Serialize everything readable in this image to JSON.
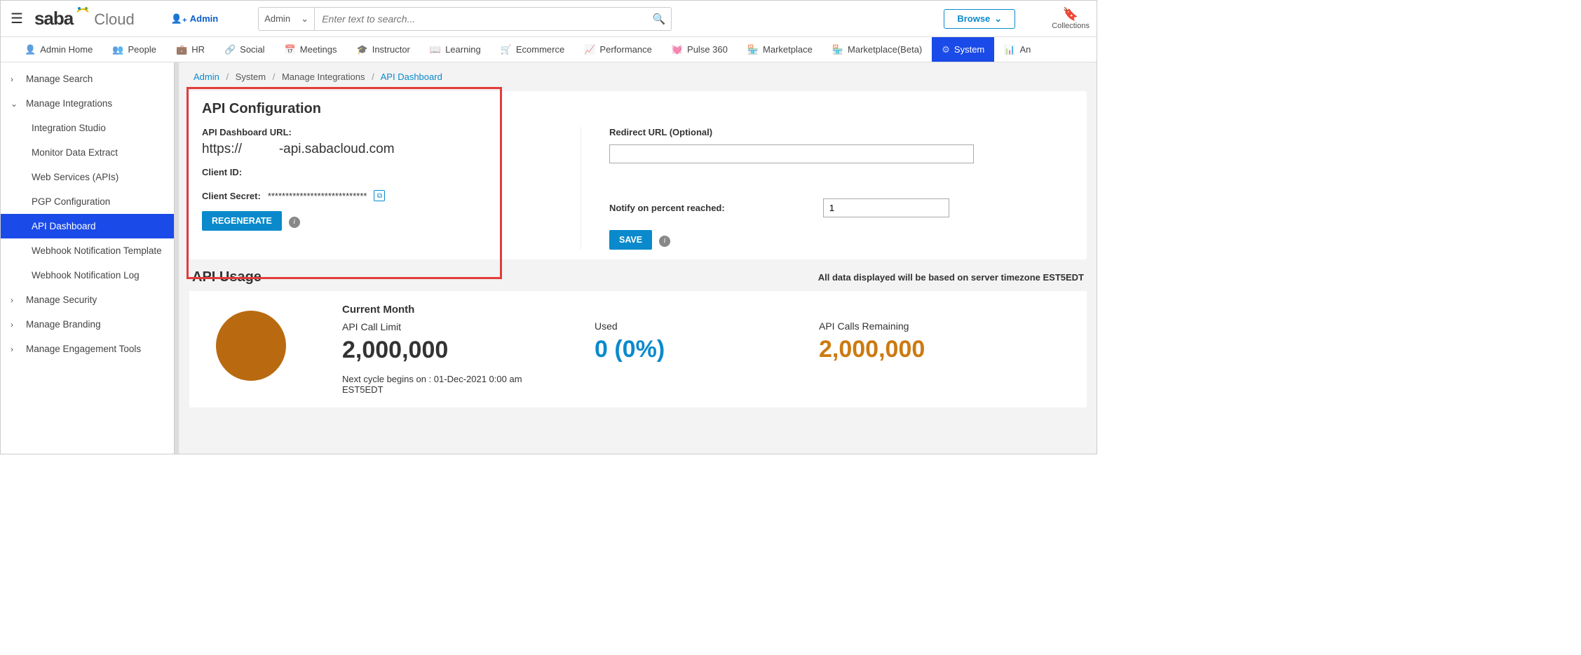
{
  "topbar": {
    "admin_label": "Admin",
    "search_scope": "Admin",
    "search_placeholder": "Enter text to search...",
    "browse_label": "Browse",
    "collections_label": "Collections"
  },
  "navtabs": [
    {
      "label": "Admin Home"
    },
    {
      "label": "People"
    },
    {
      "label": "HR"
    },
    {
      "label": "Social"
    },
    {
      "label": "Meetings"
    },
    {
      "label": "Instructor"
    },
    {
      "label": "Learning"
    },
    {
      "label": "Ecommerce"
    },
    {
      "label": "Performance"
    },
    {
      "label": "Pulse 360"
    },
    {
      "label": "Marketplace"
    },
    {
      "label": "Marketplace(Beta)"
    },
    {
      "label": "System",
      "active": true
    },
    {
      "label": "An"
    }
  ],
  "sidebar": {
    "items": [
      {
        "label": "Manage Search",
        "chev": "›"
      },
      {
        "label": "Manage Integrations",
        "chev": "⌄",
        "expanded": true,
        "children": [
          {
            "label": "Integration Studio"
          },
          {
            "label": "Monitor Data Extract"
          },
          {
            "label": "Web Services (APIs)"
          },
          {
            "label": "PGP Configuration"
          },
          {
            "label": "API Dashboard",
            "active": true
          },
          {
            "label": "Webhook Notification Template"
          },
          {
            "label": "Webhook Notification Log"
          }
        ]
      },
      {
        "label": "Manage Security",
        "chev": "›"
      },
      {
        "label": "Manage Branding",
        "chev": "›"
      },
      {
        "label": "Manage Engagement Tools",
        "chev": "›"
      }
    ]
  },
  "breadcrumb": {
    "b0": "Admin",
    "b1": "System",
    "b2": "Manage Integrations",
    "b3": "API Dashboard"
  },
  "config": {
    "title": "API Configuration",
    "url_label": "API Dashboard URL:",
    "url_value": "https://          -api.sabacloud.com",
    "client_id_label": "Client ID:",
    "client_secret_label": "Client Secret:",
    "client_secret_value": "****************************",
    "regenerate_label": "REGENERATE",
    "redirect_label": "Redirect URL (Optional)",
    "redirect_value": "",
    "notify_label": "Notify on percent reached:",
    "notify_value": "1",
    "save_label": "SAVE"
  },
  "usage": {
    "title": "API Usage",
    "tz_note": "All data displayed will be based on server timezone EST5EDT",
    "current_month_label": "Current Month",
    "limit_label": "API Call Limit",
    "limit_value": "2,000,000",
    "used_label": "Used",
    "used_value": "0 (0%)",
    "remaining_label": "API Calls Remaining",
    "remaining_value": "2,000,000",
    "next_cycle": "Next cycle begins on : 01-Dec-2021 0:00 am EST5EDT"
  },
  "chart_data": {
    "type": "pie",
    "title": "API Usage Current Month",
    "series": [
      {
        "name": "Used",
        "value": 0
      },
      {
        "name": "Remaining",
        "value": 2000000
      }
    ]
  }
}
